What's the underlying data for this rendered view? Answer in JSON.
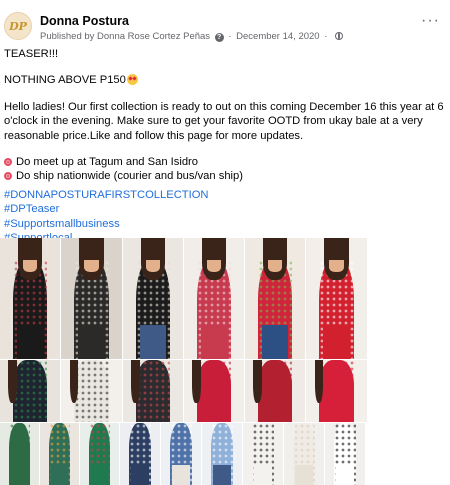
{
  "post": {
    "page_name": "Donna Postura",
    "avatar_text": "DP",
    "published_by": "Published by Donna Rose Cortez Peñas",
    "date": "December 14, 2020",
    "dot": "·",
    "more_label": "···"
  },
  "content": {
    "line1": "TEASER!!!",
    "line2": "NOTHING ABOVE P150",
    "line3": "Hello ladies! Our first collection is ready to out on this coming December 16 this year at 6 o'clock in the evening. Make sure to get your favorite OOTD from ukay bale at a very reasonable price.Like and follow this page for more updates.",
    "bullet1": "Do meet up at Tagum and San Isidro",
    "bullet2": "Do ship nationwide (courier and bus/van ship)",
    "hashtags": [
      "#DONNAPOSTURAFIRSTCOLLECTION",
      "#DPTeaser",
      "#Supportsmallbusiness",
      "#Supportlocal"
    ]
  },
  "photos": [
    {
      "bg": "#e9e3dc",
      "top": "#1a1a1a",
      "accent": "#c23b4a",
      "bottom": "#1a1a1a"
    },
    {
      "bg": "#d9d3cc",
      "top": "#2b2a28",
      "accent": "#e8e4dd",
      "bottom": "#2b2a28"
    },
    {
      "bg": "#ebe6e0",
      "top": "#1c1c1c",
      "accent": "#e4ded4",
      "bottom": "#3f5a86"
    },
    {
      "bg": "#f1eeea",
      "top": "#c83a4e",
      "accent": "#f0d6da",
      "bottom": "#c83a4e"
    },
    {
      "bg": "#efe9e2",
      "top": "#d0243c",
      "accent": "#7fb34d",
      "bottom": "#2c4f84"
    },
    {
      "bg": "#f2efeb",
      "top": "#d3202e",
      "accent": "#ffffff",
      "bottom": "#d3202e"
    },
    {
      "bg": "#e8e3dd",
      "top": "#1e2430",
      "accent": "#2e8a4a",
      "bottom": "#1e2430"
    },
    {
      "bg": "#f3f0ec",
      "top": "#e9e6e0",
      "accent": "#2d2d2d",
      "bottom": "#d8d2c8"
    },
    {
      "bg": "#ebe7e2",
      "top": "#2b2b30",
      "accent": "#d14a4a",
      "bottom": "#5a4a3a"
    },
    {
      "bg": "#f2eeea",
      "top": "#c81e3a",
      "accent": "#c81e3a",
      "bottom": "#c81e3a"
    },
    {
      "bg": "#efeae5",
      "top": "#b32030",
      "accent": "#b32030",
      "bottom": "#d9cfc4"
    },
    {
      "bg": "#f3efeb",
      "top": "#d6203a",
      "accent": "#d6203a",
      "bottom": "#e2d6cc"
    },
    {
      "bg": "#e5ebe3",
      "top": "#2c6b44",
      "accent": "#2c6b44",
      "bottom": "#2c6b44"
    },
    {
      "bg": "#eae6df",
      "top": "#2f6f57",
      "accent": "#e8a13a",
      "bottom": "#2f6f57"
    },
    {
      "bg": "#e8eee9",
      "top": "#1f7a4f",
      "accent": "#d0404a",
      "bottom": "#1f7a4f"
    },
    {
      "bg": "#eceef2",
      "top": "#2d3e63",
      "accent": "#ffffff",
      "bottom": "#2d3e63"
    },
    {
      "bg": "#eef1f4",
      "top": "#4f72a8",
      "accent": "#ffffff",
      "bottom": "#e8e3dc"
    },
    {
      "bg": "#eef0f3",
      "top": "#8fb0d8",
      "accent": "#ffffff",
      "bottom": "#3f5a86"
    },
    {
      "bg": "#f3f1ee",
      "top": "#f4f2ee",
      "accent": "#1a1a1a",
      "bottom": "#f4f2ee"
    },
    {
      "bg": "#f1efec",
      "top": "#f0ece5",
      "accent": "#d8cdbd",
      "bottom": "#e7e0d4"
    },
    {
      "bg": "#f2f0ee",
      "top": "#ffffff",
      "accent": "#111111",
      "bottom": "#ffffff"
    }
  ]
}
